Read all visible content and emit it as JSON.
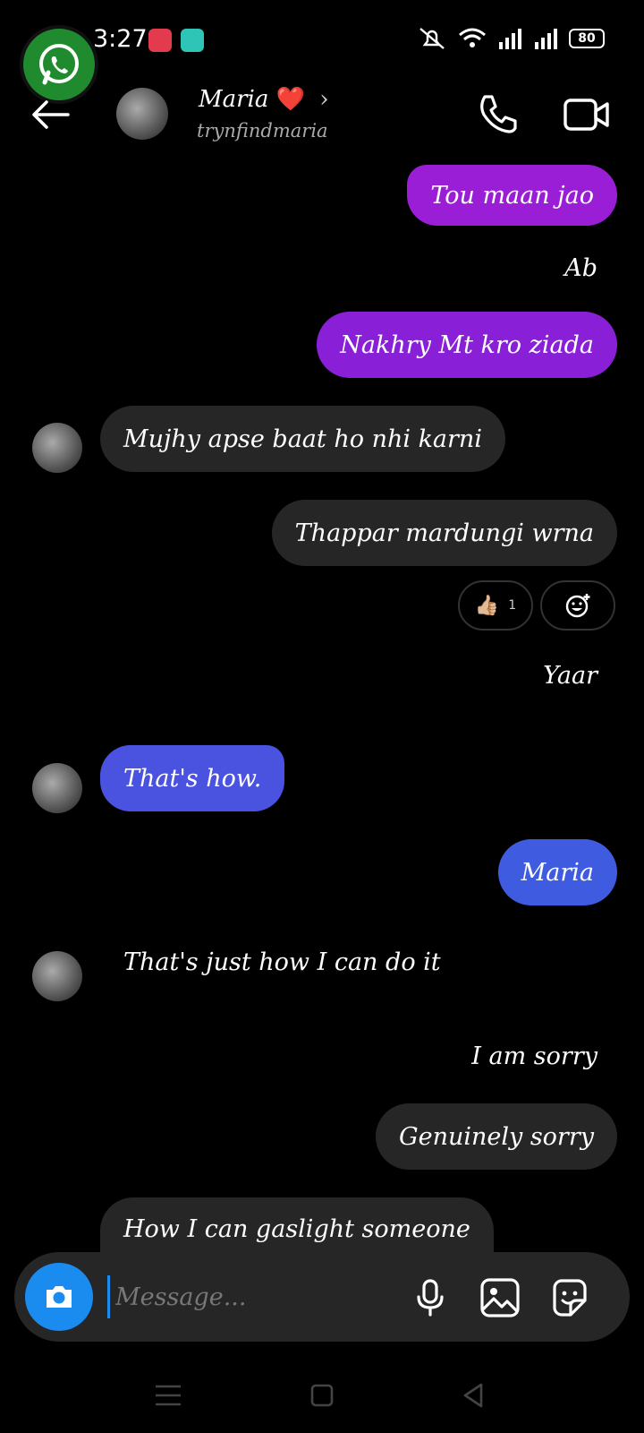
{
  "status_bar": {
    "time": "3:27",
    "battery": "80",
    "icons": [
      "whatsapp-icon",
      "screen-record-icon",
      "chat-head-icon",
      "mute-icon",
      "wifi-icon",
      "signal-icon",
      "signal-icon",
      "battery-icon"
    ]
  },
  "header": {
    "contact_name": "Maria",
    "name_emoji": "❤️",
    "username": "trynfindmaria",
    "icons": [
      "back-arrow-icon",
      "chevron-right-icon",
      "phone-icon",
      "video-icon"
    ]
  },
  "messages": [
    {
      "sender": "me",
      "text": "Tou maan jao",
      "style": "purple"
    },
    {
      "sender": "me",
      "text": "Ab",
      "style": "plain"
    },
    {
      "sender": "me",
      "text": "Nakhry Mt kro ziada",
      "style": "purple"
    },
    {
      "sender": "them",
      "text": "Mujhy apse baat ho nhi karni",
      "style": "grey"
    },
    {
      "sender": "me",
      "text": "Thappar mardungi wrna",
      "style": "grey"
    },
    {
      "sender": "me",
      "text": "Yaar",
      "style": "plain"
    },
    {
      "sender": "them",
      "text": "That's how.",
      "style": "blue"
    },
    {
      "sender": "me",
      "text": "Maria",
      "style": "blue"
    },
    {
      "sender": "them",
      "text": "That's just how I can do it",
      "style": "plain"
    },
    {
      "sender": "me",
      "text": "I am sorry",
      "style": "plain"
    },
    {
      "sender": "me",
      "text": "Genuinely sorry",
      "style": "grey"
    },
    {
      "sender": "them",
      "text": "How I can gaslight someone",
      "style": "grey"
    }
  ],
  "reaction": {
    "emoji": "👍🏼",
    "count": "1"
  },
  "composer": {
    "placeholder": "Message..."
  },
  "colors": {
    "purple": "#9a1ed6",
    "blue": "#4a52e0",
    "grey": "#262626",
    "camera": "#1a8cf0"
  }
}
